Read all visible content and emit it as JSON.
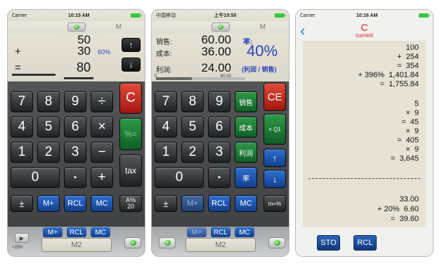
{
  "phone1": {
    "status": {
      "carrier": "Carrier",
      "time": "10:15 AM"
    },
    "memory_label": "M",
    "display": {
      "line1": "50",
      "op2": "+",
      "line2": "30",
      "pct": "60%",
      "op3": "=",
      "line3": "80"
    },
    "arrows": {
      "up": "↑",
      "down": "↓"
    },
    "keys": {
      "k7": "7",
      "k8": "8",
      "k9": "9",
      "div": "÷",
      "clear": "C",
      "k4": "4",
      "k5": "5",
      "k6": "6",
      "mul": "×",
      "pcteq": "%=",
      "k1": "1",
      "k2": "2",
      "k3": "3",
      "minus": "−",
      "tax": "tax",
      "k0": "0",
      "dot": "•",
      "plus": "+",
      "pm": "±",
      "mplus": "M+",
      "rcl": "RCL",
      "mc": "MC",
      "apct_top": "A%",
      "apct_bottom": "20"
    },
    "strip": {
      "play": "▶",
      "rate": "+25%",
      "mplus": "M+",
      "rcl": "RCL",
      "mc": "MC",
      "m2": "M2"
    }
  },
  "phone2": {
    "status": {
      "carrier": "中国移动",
      "time": "上午10:50"
    },
    "memory_label": "M",
    "display": {
      "sales_label": "销售:",
      "sales_value": "60.00",
      "cost_label": "成本:",
      "cost_value": "36.00",
      "profit_label": "利润:",
      "profit_value": "24.00",
      "rate_label": "率:",
      "rate_value": "40%",
      "rate_note": "(利润 / 销售)",
      "scale_min": "0",
      "scale_max": "60.00",
      "scale_fill": 0.4
    },
    "keys": {
      "k7": "7",
      "k8": "8",
      "k9": "9",
      "sales": "销售",
      "ce": "CE",
      "k4": "4",
      "k5": "5",
      "k6": "6",
      "cost": "成本",
      "xq1": "× Q1",
      "k1": "1",
      "k2": "2",
      "k3": "3",
      "profit": "利润",
      "up": "↑",
      "k0": "0",
      "dot": "•",
      "rate": "率",
      "down": "↓",
      "pm": "±",
      "mplus": "M+",
      "rcl": "RCL",
      "mc": "MC",
      "mpct": "m=%"
    },
    "strip": {
      "mplus": "M+",
      "rcl": "RCL",
      "mc": "MC",
      "m2": "M2"
    }
  },
  "phone3": {
    "status": {
      "carrier": "Carrier",
      "time": "10:16 AM"
    },
    "nav": {
      "back": "‹",
      "title": "C",
      "subtitle": "current"
    },
    "tape": [
      "100",
      "+  254",
      "=  354",
      "+ 396%  1,401.84",
      "=  1,755.84",
      "5",
      "×  9",
      "=  45",
      "×  9",
      "=  405",
      "×  9",
      "=  3,645",
      "33.00",
      "+ 20%  6.60",
      "=  39.60"
    ],
    "buttons": {
      "sto": "STO",
      "rcl": "RCL"
    }
  }
}
